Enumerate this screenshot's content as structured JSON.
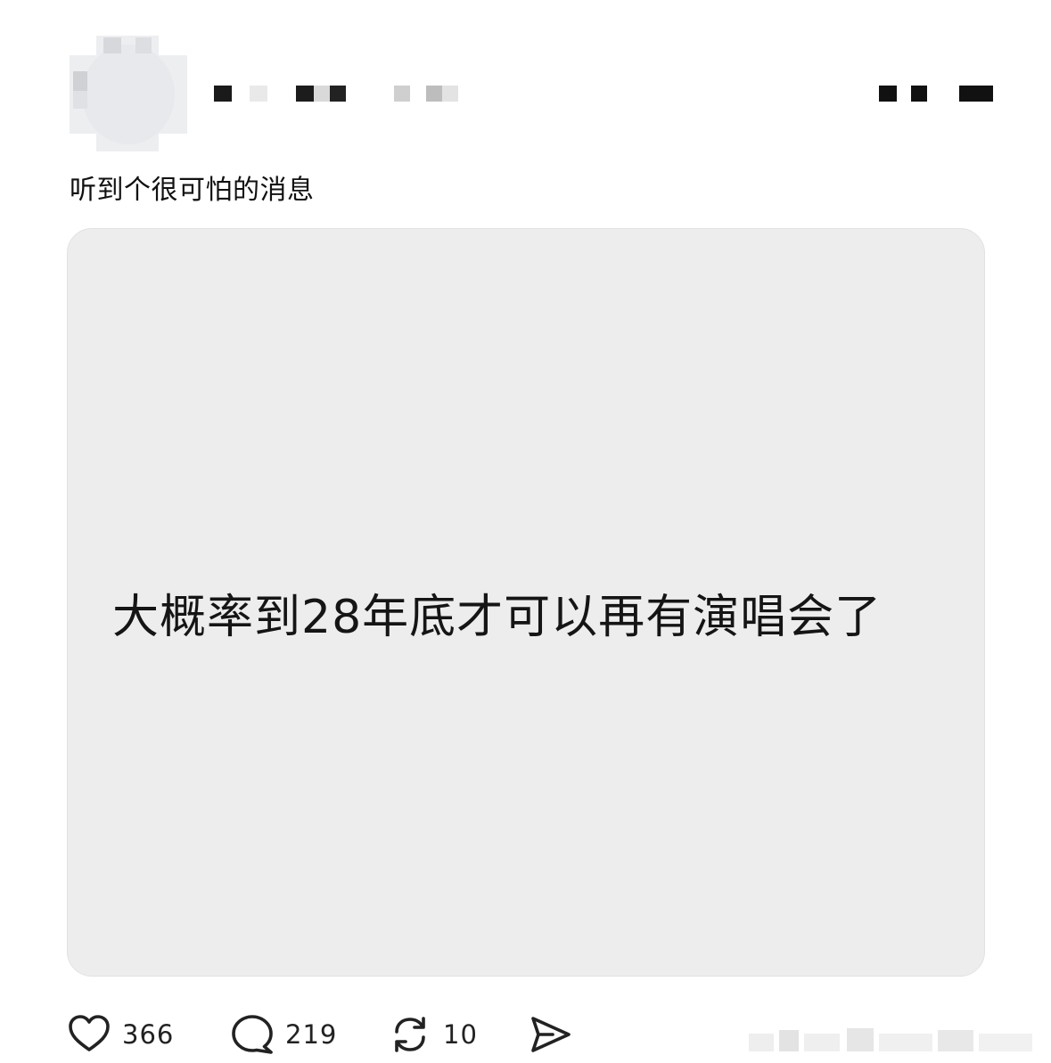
{
  "post": {
    "text": "听到个很可怕的消息",
    "image_text": "大概率到28年底才可以再有演唱会了"
  },
  "actions": {
    "likes": "366",
    "comments": "219",
    "reposts": "10"
  },
  "colors": {
    "card_bg": "#ededee",
    "text": "#111111",
    "icon": "#222222"
  },
  "icons": [
    "heart-icon",
    "comment-icon",
    "repost-icon",
    "share-icon"
  ]
}
